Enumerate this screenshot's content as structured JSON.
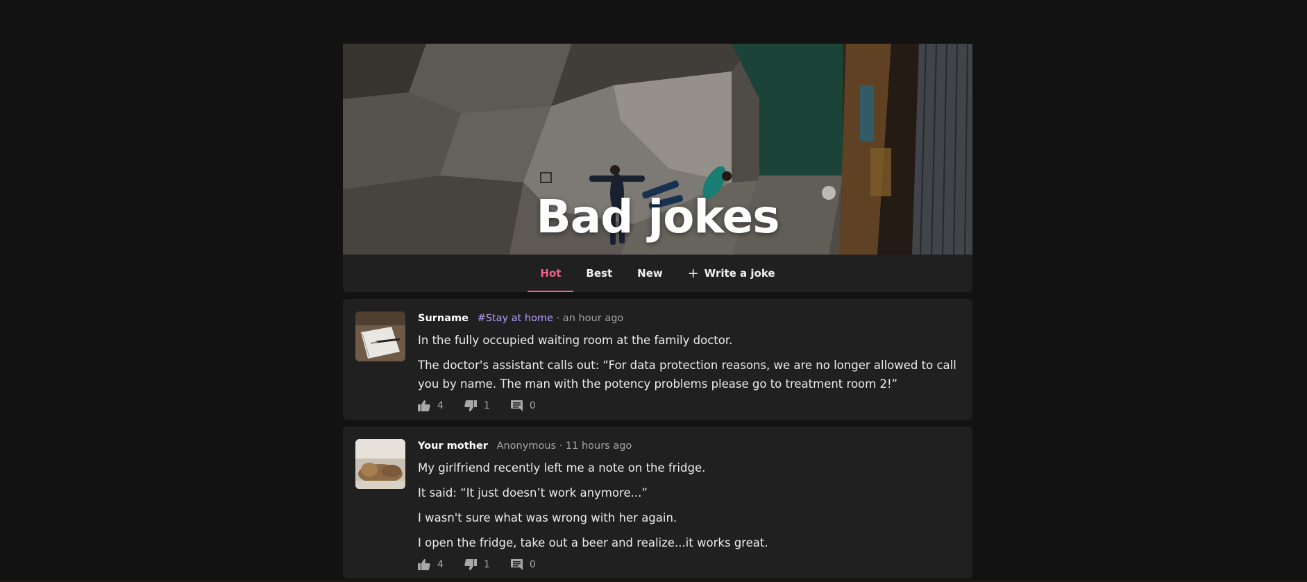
{
  "hero": {
    "title": "Bad jokes"
  },
  "tabs": [
    {
      "label": "Hot",
      "active": true
    },
    {
      "label": "Best",
      "active": false
    },
    {
      "label": "New",
      "active": false
    },
    {
      "label": "Write a joke",
      "icon": "plus-icon"
    }
  ],
  "posts": [
    {
      "author": "Surname",
      "tag": "#Stay at home",
      "time": "· an hour ago",
      "paragraphs": [
        "In the fully occupied waiting room at the family doctor.",
        "The doctor's assistant calls out: “For data protection reasons, we are no longer allowed to call you by name. The man with the potency problems please go to treatment room 2!”"
      ],
      "likes": "4",
      "dislikes": "1",
      "comments": "0"
    },
    {
      "author": "Your mother",
      "tag": "Anonymous",
      "time": "· 11 hours ago",
      "paragraphs": [
        "My girlfriend recently left me a note on the fridge.",
        "It said: “It just doesn’t work anymore...”",
        "I wasn't sure what was wrong with her again.",
        "I open the fridge, take out a beer and realize...it works great."
      ],
      "likes": "4",
      "dislikes": "1",
      "comments": "0"
    }
  ],
  "colors": {
    "accent": "#f0608a",
    "tag": "#b9a3ff",
    "card": "#202020",
    "page": "#121212"
  }
}
